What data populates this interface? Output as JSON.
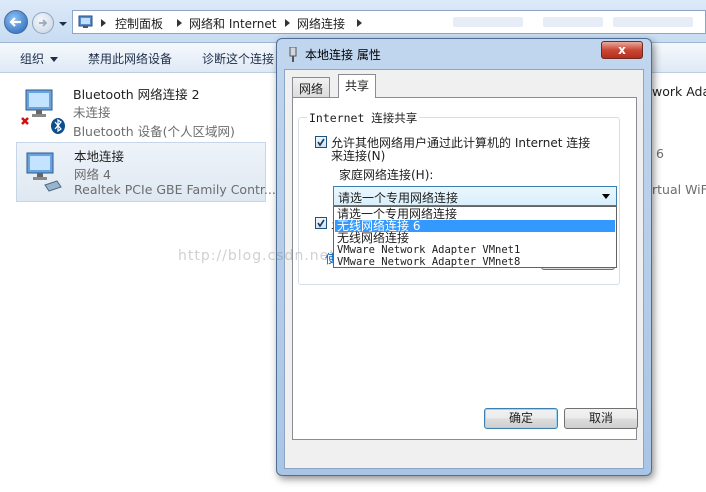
{
  "explorer": {
    "breadcrumb": [
      "控制面板",
      "网络和 Internet",
      "网络连接"
    ],
    "toolbar": {
      "organize": "组织",
      "disable": "禁用此网络设备",
      "diagnose": "诊断这个连接"
    },
    "connections": [
      {
        "name": "Bluetooth 网络连接 2",
        "status": "未连接",
        "device": "Bluetooth 设备(个人区域网)"
      },
      {
        "name": "本地连接",
        "status": "网络  4",
        "device": "Realtek PCIe GBE Family Contr..."
      }
    ],
    "right_fragments": [
      "work Ada",
      "6",
      "rtual WiFi"
    ]
  },
  "watermark": "http://blog.csdn.net/___524",
  "dialog": {
    "title": "本地连接 属性",
    "close_label": "x",
    "tabs": [
      "网络",
      "共享"
    ],
    "active_tab": "共享",
    "group_title": "Internet 连接共享",
    "allow_share_line1": "允许其他网络用户通过此计算机的 Internet 连接",
    "allow_share_line2": "来连接(N)",
    "home_network_label": "家庭网络连接(H):",
    "combo_value": "请选一个专用网络连接",
    "dropdown_options": [
      "请选一个专用网络连接",
      "无线网络连接 6",
      "无线网络连接",
      "VMware Network Adapter VMnet1",
      "VMware Network Adapter VMnet8"
    ],
    "selected_option_index": 1,
    "second_checkbox_label": "允",
    "settings_link": "使",
    "ok_label": "确定",
    "cancel_label": "取消"
  }
}
